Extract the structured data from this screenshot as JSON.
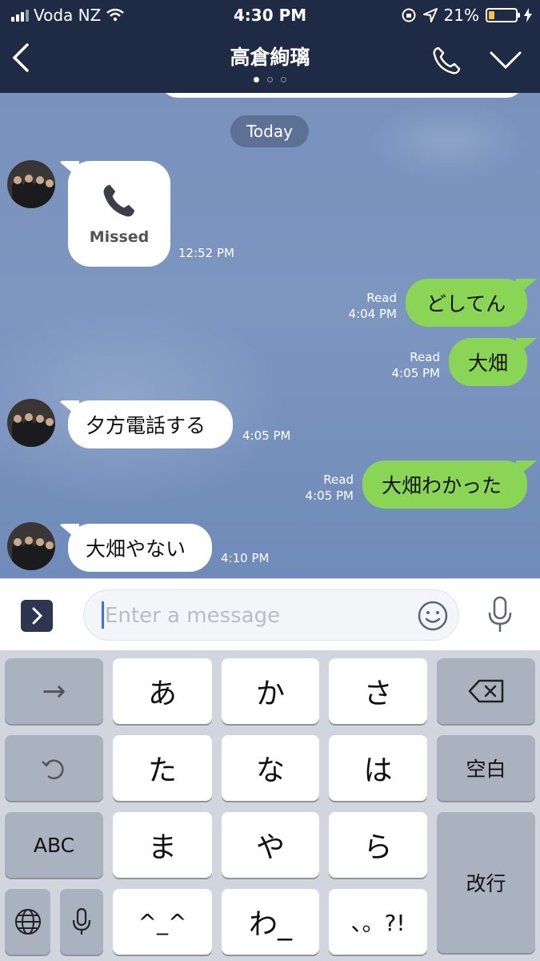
{
  "status_bar": {
    "carrier": "Voda NZ",
    "time": "4:30 PM",
    "battery": "21%",
    "battery_level": 0.21
  },
  "header": {
    "title": "高倉絢璃",
    "back_icon": "chevron-left-icon",
    "call_icon": "phone-icon",
    "menu_icon": "chevron-down-icon",
    "page_dots": 3,
    "active_dot": 0
  },
  "chat": {
    "date_label": "Today",
    "messages": [
      {
        "side": "in",
        "type": "call",
        "text": "Missed",
        "time": "12:52 PM"
      },
      {
        "side": "out",
        "text": "どしてん",
        "read": "Read",
        "time": "4:04 PM"
      },
      {
        "side": "out",
        "text": "大畑",
        "read": "Read",
        "time": "4:05 PM"
      },
      {
        "side": "in",
        "text": "夕方電話する",
        "time": "4:05 PM"
      },
      {
        "side": "out",
        "text": "大畑わかった",
        "read": "Read",
        "time": "4:05 PM"
      },
      {
        "side": "in",
        "text": "大畑やない",
        "time": "4:10 PM"
      }
    ]
  },
  "input": {
    "placeholder": "Enter a message",
    "expand_icon": "chevron-right-icon",
    "emoji_icon": "smiley-icon",
    "mic_icon": "microphone-icon"
  },
  "keyboard": {
    "keys": {
      "arrow": "→",
      "a": "あ",
      "ka": "か",
      "sa": "さ",
      "ta": "た",
      "na": "な",
      "ha": "は",
      "space": "空白",
      "abc": "ABC",
      "ma": "ま",
      "ya": "や",
      "ra": "ら",
      "enter": "改行",
      "caret": "^_^",
      "wa": "わ_",
      "punct": "、。?!"
    },
    "icons": [
      "backspace-icon",
      "undo-icon",
      "globe-icon",
      "keyboard-mic-icon"
    ]
  }
}
